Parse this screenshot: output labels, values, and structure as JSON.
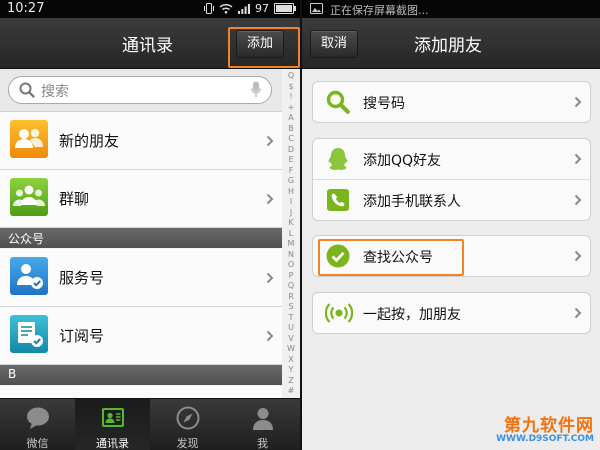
{
  "left": {
    "status": {
      "time": "10:27",
      "battery": "97",
      "battery_level": 0.97
    },
    "title": "通讯录",
    "add_button": "添加",
    "search_placeholder": "搜索",
    "rows": [
      {
        "label": "新的朋友",
        "icon": "new-friends-icon"
      },
      {
        "label": "群聊",
        "icon": "group-chat-icon"
      }
    ],
    "section_public": "公众号",
    "public_rows": [
      {
        "label": "服务号",
        "icon": "service-account-icon"
      },
      {
        "label": "订阅号",
        "icon": "subscription-account-icon"
      }
    ],
    "section_b": "B",
    "index_letters": [
      "Q",
      "$",
      "!",
      "+",
      "A",
      "B",
      "C",
      "D",
      "E",
      "F",
      "G",
      "H",
      "I",
      "J",
      "K",
      "L",
      "M",
      "N",
      "O",
      "P",
      "Q",
      "R",
      "S",
      "T",
      "U",
      "V",
      "W",
      "X",
      "Y",
      "Z",
      "#"
    ],
    "nav": [
      {
        "label": "微信",
        "icon": "chat-bubble-icon",
        "active": false
      },
      {
        "label": "通讯录",
        "icon": "contacts-icon",
        "active": true
      },
      {
        "label": "发现",
        "icon": "compass-icon",
        "active": false
      },
      {
        "label": "我",
        "icon": "person-icon",
        "active": false
      }
    ]
  },
  "right": {
    "status": {
      "notice": "正在保存屏幕截图..."
    },
    "cancel_button": "取消",
    "title": "添加朋友",
    "items": [
      {
        "label": "搜号码",
        "icon": "search-icon"
      },
      {
        "label": "添加QQ好友",
        "icon": "qq-icon"
      },
      {
        "label": "添加手机联系人",
        "icon": "phone-icon"
      },
      {
        "label": "查找公众号",
        "icon": "check-circle-icon"
      },
      {
        "label": "一起按，加朋友",
        "icon": "radar-icon"
      }
    ]
  },
  "watermark": {
    "line1": "第九软件网",
    "line2": "WWW.D9SOFT.COM"
  },
  "colors": {
    "highlight": "#f08426",
    "accent_green": "#7ab51d",
    "titlebar": "#2f2f2f"
  }
}
